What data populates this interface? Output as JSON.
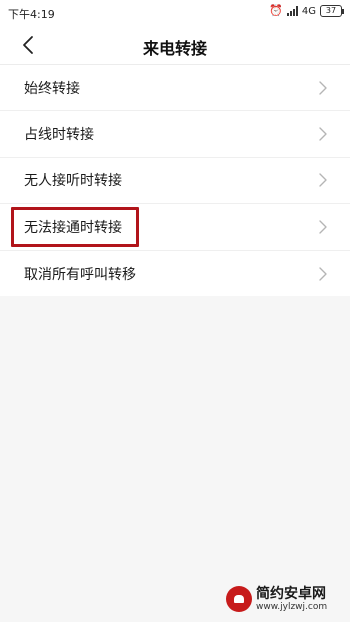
{
  "status_bar": {
    "time": "下午4:19",
    "network": "4G",
    "battery": "37",
    "alarm_icon": "alarm-clock-icon",
    "signal_icon": "signal-bars-icon"
  },
  "header": {
    "title": "来电转接",
    "back_icon": "chevron-left-icon"
  },
  "list": {
    "items": [
      {
        "label": "始终转接"
      },
      {
        "label": "占线时转接"
      },
      {
        "label": "无人接听时转接"
      },
      {
        "label": "无法接通时转接",
        "highlighted": true
      },
      {
        "label": "取消所有呼叫转移"
      }
    ],
    "chevron_icon": "chevron-right-icon"
  },
  "colors": {
    "highlight_border": "#b1141a",
    "background": "#f6f6f6",
    "surface": "#ffffff"
  },
  "watermark": {
    "name": "简约安卓网",
    "url": "www.jylzwj.com",
    "logo_icon": "android-logo-icon"
  }
}
